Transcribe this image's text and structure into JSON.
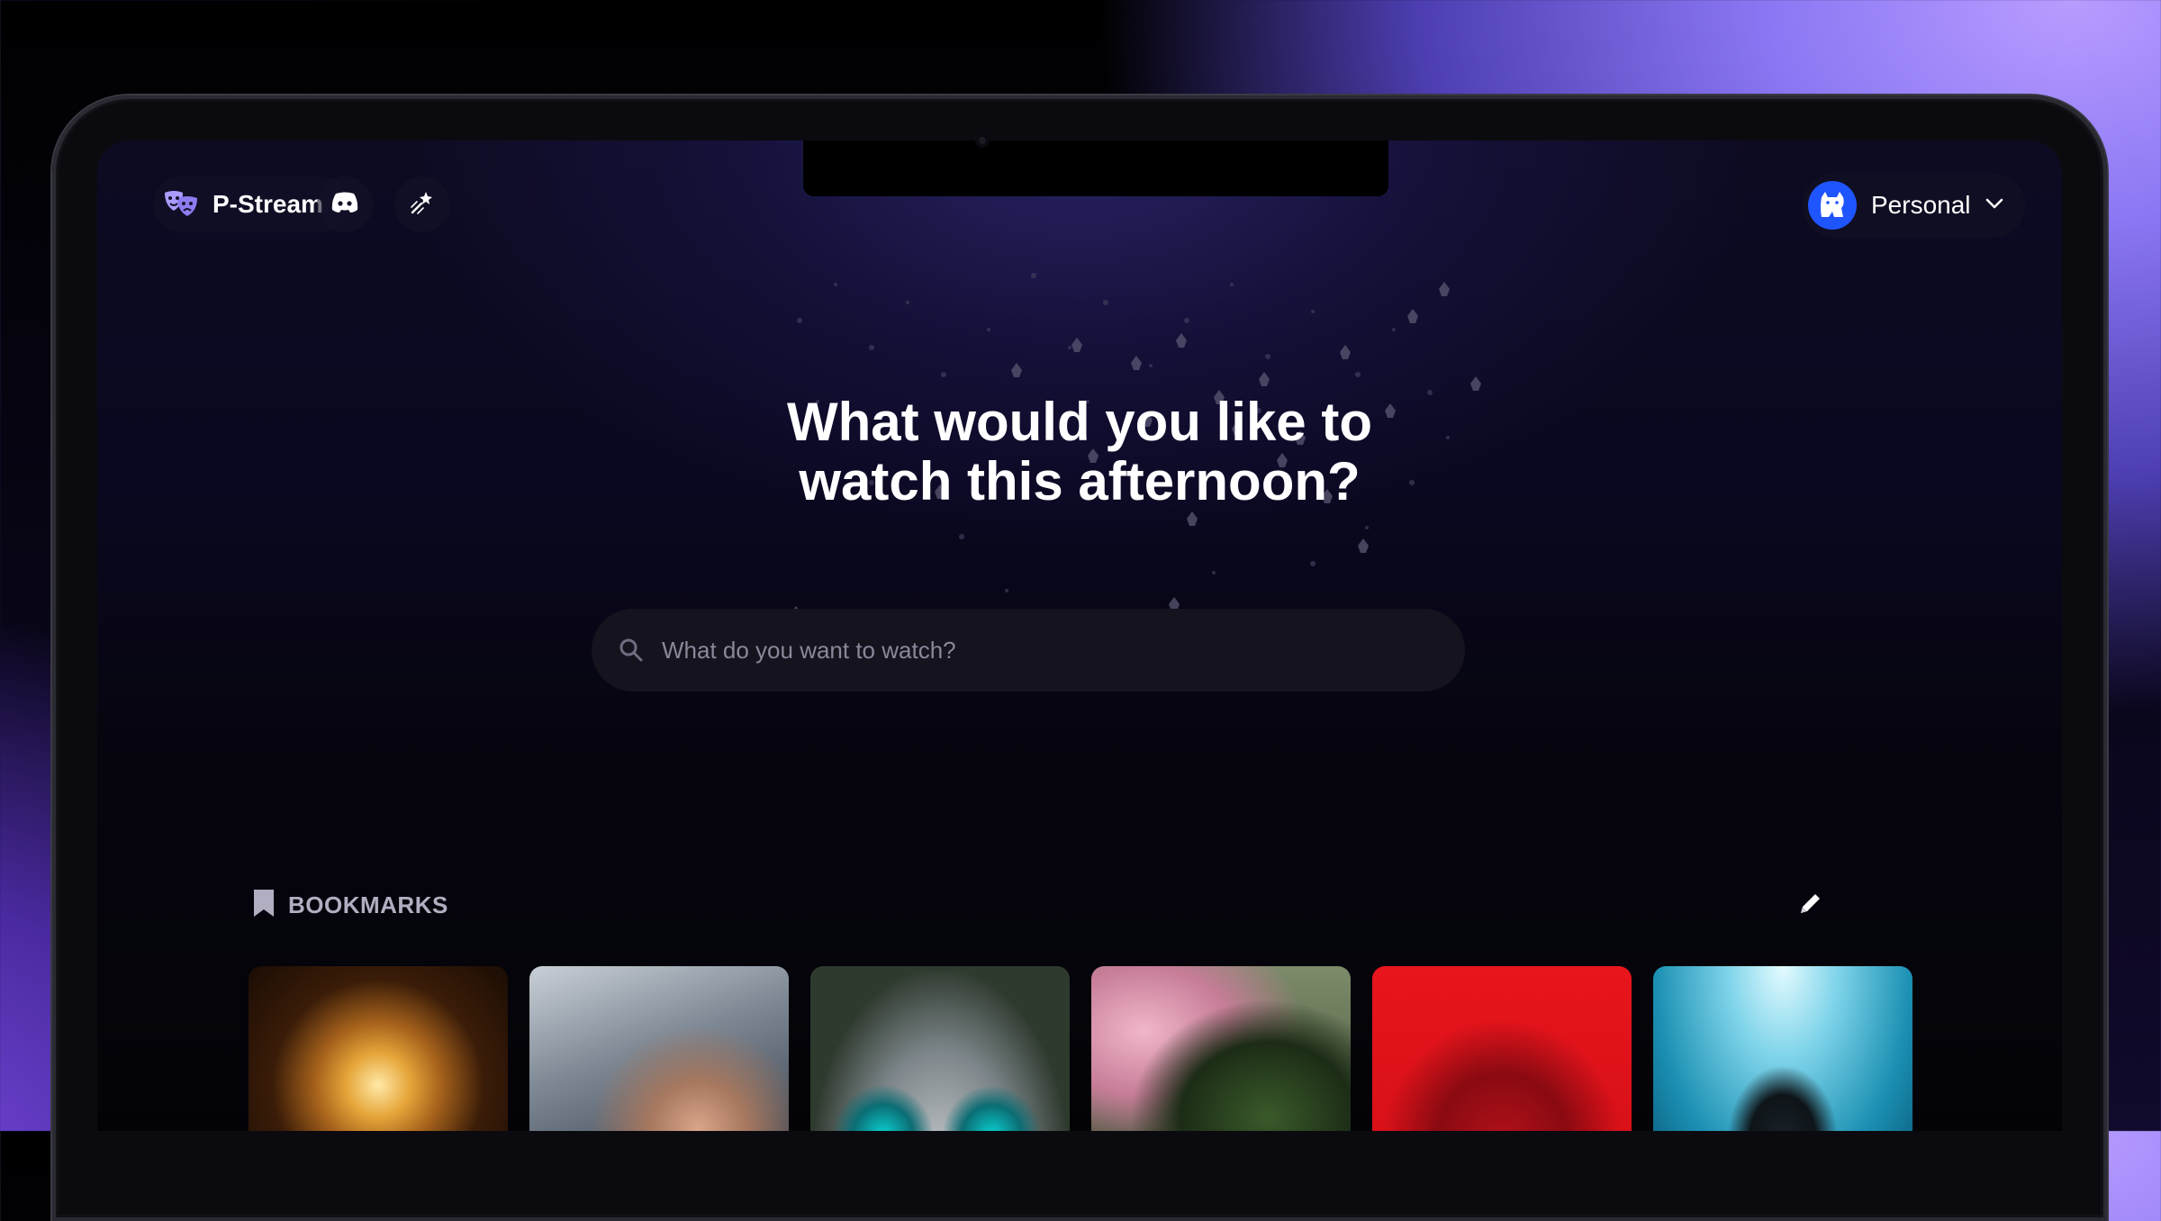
{
  "nav": {
    "brand": "P-Stream",
    "discord_icon": "discord-icon",
    "settings_icon": "wand-icon"
  },
  "profile": {
    "name": "Personal",
    "avatar_icon": "cat-icon",
    "avatar_color": "#1f55ff"
  },
  "hero": {
    "line1": "What would you like to",
    "line2": "watch this afternoon?"
  },
  "search": {
    "placeholder": "What do you want to watch?"
  },
  "bookmarks": {
    "title": "BOOKMARKS",
    "items": [
      {
        "poster": "gold-disco-ball-poster"
      },
      {
        "poster": "man-portrait-poster"
      },
      {
        "poster": "robot-eyes-poster"
      },
      {
        "poster": "green-witch-poster"
      },
      {
        "poster": "red-rose-hood-poster"
      },
      {
        "poster": "black-cat-underwater-poster"
      }
    ]
  },
  "colors": {
    "accent": "#a89cff",
    "avatar": "#1f55ff",
    "search_bg": "#14131e"
  }
}
